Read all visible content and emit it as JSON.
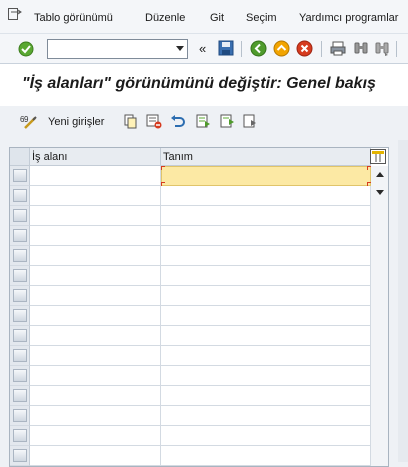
{
  "menu": {
    "items": [
      {
        "label": "Tablo görünümü"
      },
      {
        "label": "Düzenle"
      },
      {
        "label": "Git"
      },
      {
        "label": "Seçim"
      },
      {
        "label": "Yardımcı programlar"
      }
    ]
  },
  "toolbar": {
    "command_value": ""
  },
  "title": "\"İş alanları\" görünümünü değiştir: Genel bakış",
  "app_toolbar": {
    "new_entries_label": "Yeni girişler"
  },
  "table": {
    "columns": [
      "İş alanı",
      "Tanım"
    ],
    "rows": [
      [
        "",
        ""
      ],
      [
        "",
        ""
      ],
      [
        "",
        ""
      ],
      [
        "",
        ""
      ],
      [
        "",
        ""
      ],
      [
        "",
        ""
      ],
      [
        "",
        ""
      ],
      [
        "",
        ""
      ],
      [
        "",
        ""
      ],
      [
        "",
        ""
      ],
      [
        "",
        ""
      ],
      [
        "",
        ""
      ],
      [
        "",
        ""
      ],
      [
        "",
        ""
      ],
      [
        "",
        ""
      ]
    ]
  },
  "colors": {
    "focus_cell": "#fce9a4",
    "title_bg": "#ffffff",
    "accent_red": "#d63b1f"
  }
}
